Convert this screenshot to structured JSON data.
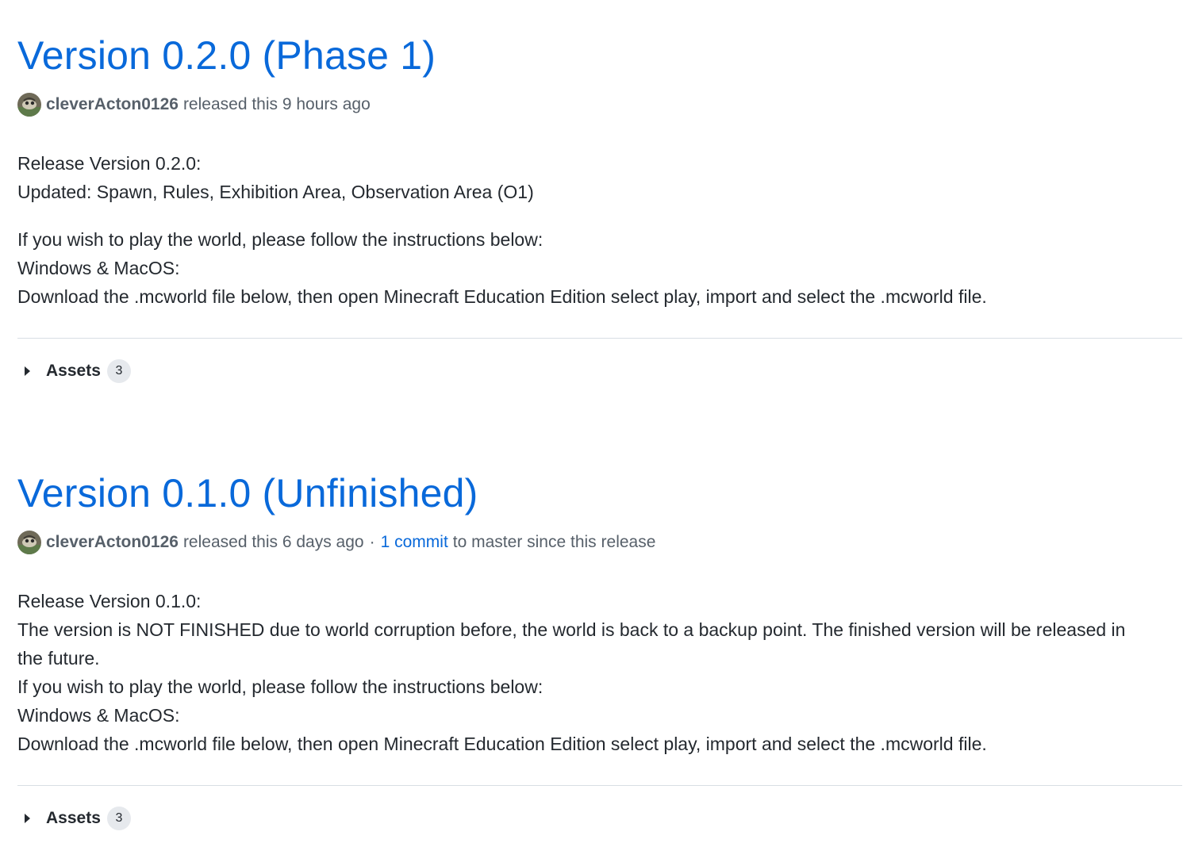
{
  "releases": [
    {
      "title": "Version 0.2.0 (Phase 1)",
      "author": "cleverActon0126",
      "released_text": "released this 9 hours ago",
      "body": {
        "p1": [
          "Release Version 0.2.0:",
          "Updated: Spawn, Rules, Exhibition Area, Observation Area (O1)"
        ],
        "p2": [
          "If you wish to play the world, please follow the instructions below:",
          "Windows & MacOS:",
          "Download the .mcworld file below, then open Minecraft Education Edition select play, import and select the .mcworld file."
        ]
      },
      "assets_label": "Assets",
      "assets_count": "3"
    },
    {
      "title": "Version 0.1.0 (Unfinished)",
      "author": "cleverActon0126",
      "released_text": "released this 6 days ago",
      "separator": "·",
      "commit_link": "1 commit",
      "commit_suffix": "to master since this release",
      "body": {
        "p1": [
          "Release Version 0.1.0:",
          "The version is NOT FINISHED due to world corruption before, the world is back to a backup point. The finished version will be released in",
          "the future.",
          "If you wish to play the world, please follow the instructions below:",
          "Windows & MacOS:",
          "Download the .mcworld file below, then open Minecraft Education Edition select play, import and select the .mcworld file."
        ]
      },
      "assets_label": "Assets",
      "assets_count": "3"
    }
  ],
  "colors": {
    "link": "#0969da",
    "text": "#24292f",
    "muted": "#57606a",
    "divider": "#d8dee4",
    "counter_bg": "#e6e9ed"
  }
}
